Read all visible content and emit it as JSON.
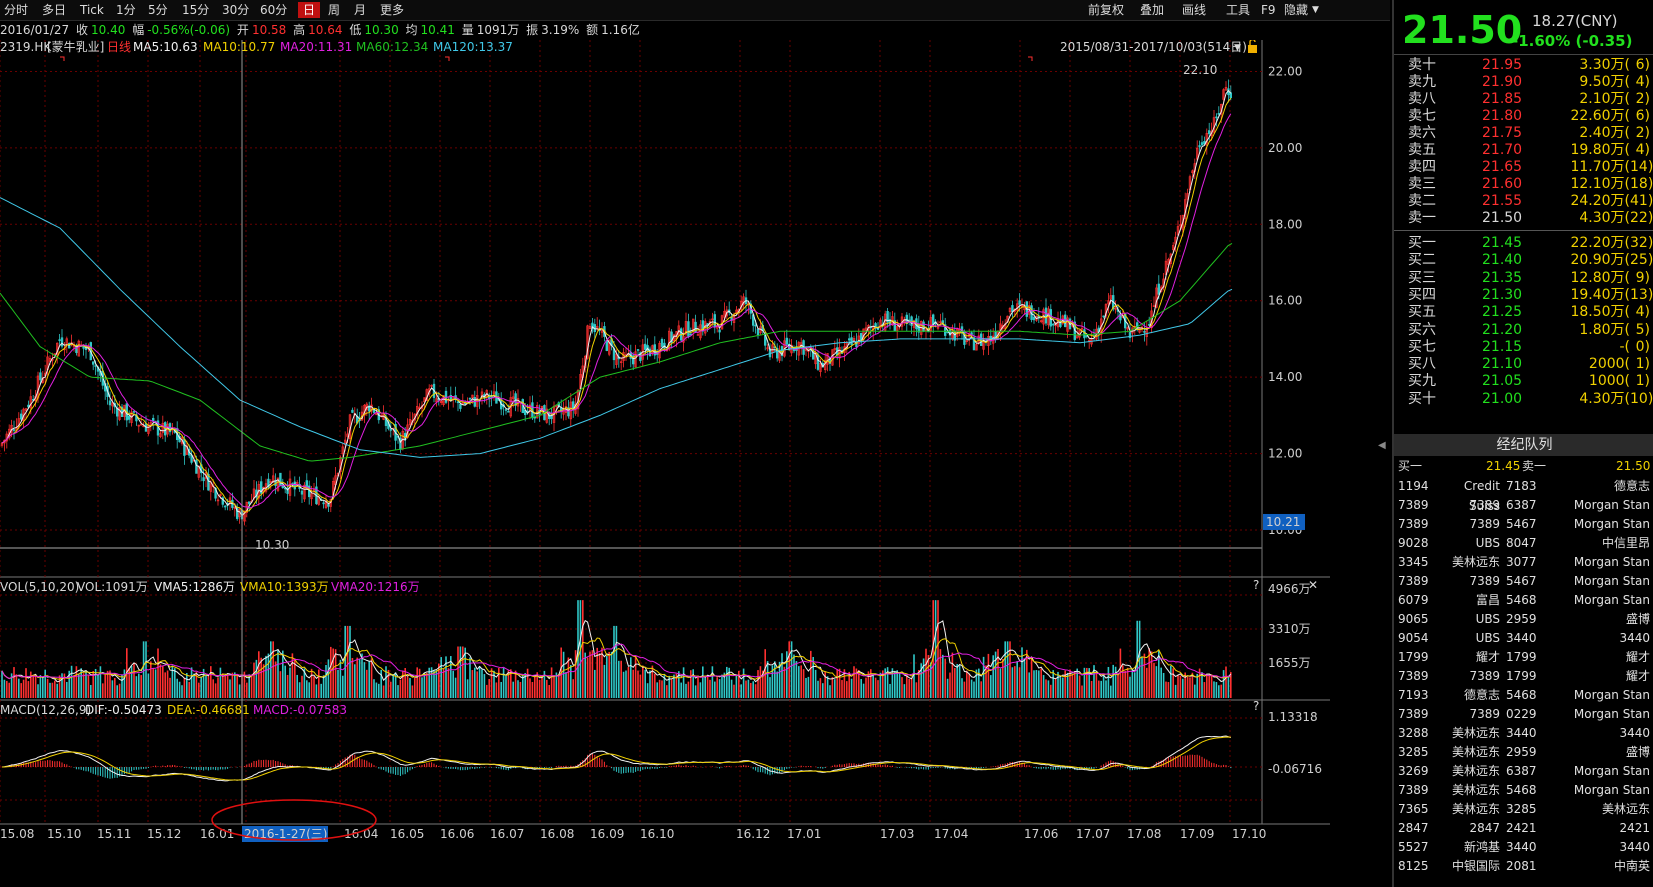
{
  "toolbar": {
    "items": [
      "分时",
      "多日",
      "Tick",
      "1分",
      "5分",
      "15分",
      "30分",
      "60分",
      "日",
      "周",
      "月",
      "更多"
    ],
    "active": "日",
    "right_items": [
      "前复权",
      "叠加",
      "画线",
      "工具",
      "F9",
      "隐藏"
    ]
  },
  "infoline": {
    "date": "2016/01/27",
    "close_label": "收",
    "close": "10.40",
    "change_label": "幅",
    "change": "-0.56%(-0.06)",
    "open_label": "开",
    "open": "10.58",
    "high_label": "高",
    "high": "10.64",
    "low_label": "低",
    "low": "10.30",
    "avg_label": "均",
    "avg": "10.41",
    "volume_label": "量",
    "volume": "1091万",
    "amplitude_label": "振",
    "amplitude": "3.19%",
    "turnover_label": "额",
    "turnover": "1.16亿"
  },
  "main_legend": {
    "symbol": "2319.HK",
    "name": "[蒙牛乳业]",
    "period": "日线",
    "ma5": "MA5:10.63",
    "ma10": "MA10:10.77",
    "ma20": "MA20:11.31",
    "ma60": "MA60:12.34",
    "ma120": "MA120:13.37",
    "range": "2015/08/31-2017/10/03(514日)"
  },
  "colors": {
    "up": "#ff3030",
    "down": "#30c8c8",
    "ma5": "#f0f0f0",
    "ma10": "#f0d000",
    "ma20": "#e020e0",
    "ma60": "#20c020",
    "ma120": "#40c8e8",
    "grid": "#6a0000",
    "green": "#22e01e"
  },
  "price_axis": {
    "labels": [
      "22.00",
      "20.00",
      "18.00",
      "16.00",
      "14.00",
      "12.00",
      "10.00"
    ],
    "current_marker": "10.21",
    "high_mark": "22.10",
    "low_mark": "10.30"
  },
  "vol_legend": {
    "name": "VOL(5,10,20)",
    "vol": "VOL:1091万",
    "vma5": "VMA5:1286万",
    "vma10": "VMA10:1393万",
    "vma20": "VMA20:1216万",
    "axis": [
      "4966万",
      "3310万",
      "1655万"
    ]
  },
  "macd_legend": {
    "name": "MACD(12,26,9)",
    "dif": "DIF:-0.50473",
    "dea": "DEA:-0.46681",
    "macd": "MACD:-0.07583",
    "axis": [
      "1.13318",
      "-0.06716"
    ]
  },
  "time_axis": {
    "labels": [
      "15.08",
      "15.10",
      "15.11",
      "15.12",
      "16.01",
      "16.04",
      "16.05",
      "16.06",
      "16.07",
      "16.08",
      "16.09",
      "16.10",
      "16.12",
      "17.01",
      "17.03",
      "17.04",
      "17.06",
      "17.07",
      "17.08",
      "17.09",
      "17.10"
    ],
    "cursor_label": "2016-1-27(三)"
  },
  "quote": {
    "price": "21.50",
    "ref": "18.27(CNY)",
    "change": "-1.60% (-0.35)"
  },
  "orderbook": {
    "asks": [
      {
        "label": "卖十",
        "price": "21.95",
        "vol": "3.30万(",
        "cnt": "6)"
      },
      {
        "label": "卖九",
        "price": "21.90",
        "vol": "9.50万(",
        "cnt": "4)"
      },
      {
        "label": "卖八",
        "price": "21.85",
        "vol": "2.10万(",
        "cnt": "2)"
      },
      {
        "label": "卖七",
        "price": "21.80",
        "vol": "22.60万(",
        "cnt": "6)"
      },
      {
        "label": "卖六",
        "price": "21.75",
        "vol": "2.40万(",
        "cnt": "2)"
      },
      {
        "label": "卖五",
        "price": "21.70",
        "vol": "19.80万(",
        "cnt": "4)"
      },
      {
        "label": "卖四",
        "price": "21.65",
        "vol": "11.70万(",
        "cnt": "14)"
      },
      {
        "label": "卖三",
        "price": "21.60",
        "vol": "12.10万(",
        "cnt": "18)"
      },
      {
        "label": "卖二",
        "price": "21.55",
        "vol": "24.20万(",
        "cnt": "41)"
      },
      {
        "label": "卖一",
        "price": "21.50",
        "vol": "4.30万(",
        "cnt": "22)"
      }
    ],
    "bids": [
      {
        "label": "买一",
        "price": "21.45",
        "vol": "22.20万(",
        "cnt": "32)"
      },
      {
        "label": "买二",
        "price": "21.40",
        "vol": "20.90万(",
        "cnt": "25)"
      },
      {
        "label": "买三",
        "price": "21.35",
        "vol": "12.80万(",
        "cnt": "9)"
      },
      {
        "label": "买四",
        "price": "21.30",
        "vol": "19.40万(",
        "cnt": "13)"
      },
      {
        "label": "买五",
        "price": "21.25",
        "vol": "18.50万(",
        "cnt": "4)"
      },
      {
        "label": "买六",
        "price": "21.20",
        "vol": "1.80万(",
        "cnt": "5)"
      },
      {
        "label": "买七",
        "price": "21.15",
        "vol": "-(",
        "cnt": "0)"
      },
      {
        "label": "买八",
        "price": "21.10",
        "vol": "2000(",
        "cnt": "1)"
      },
      {
        "label": "买九",
        "price": "21.05",
        "vol": "1000(",
        "cnt": "1)"
      },
      {
        "label": "买十",
        "price": "21.00",
        "vol": "4.30万(",
        "cnt": "10)"
      }
    ]
  },
  "broker": {
    "title": "经纪队列",
    "buy_label": "买一",
    "buy_price": "21.45",
    "sell_label": "卖一",
    "sell_price": "21.50",
    "rows": [
      [
        "1194",
        "Credit Suiss",
        "7183",
        "德意志"
      ],
      [
        "7389",
        "7389",
        "6387",
        "Morgan Stan"
      ],
      [
        "7389",
        "7389",
        "5467",
        "Morgan Stan"
      ],
      [
        "9028",
        "UBS",
        "8047",
        "中信里昂"
      ],
      [
        "3345",
        "美林远东",
        "3077",
        "Morgan Stan"
      ],
      [
        "7389",
        "7389",
        "5467",
        "Morgan Stan"
      ],
      [
        "6079",
        "富昌",
        "5468",
        "Morgan Stan"
      ],
      [
        "9065",
        "UBS",
        "2959",
        "盛博"
      ],
      [
        "9054",
        "UBS",
        "3440",
        "3440"
      ],
      [
        "1799",
        "耀才",
        "1799",
        "耀才"
      ],
      [
        "7389",
        "7389",
        "1799",
        "耀才"
      ],
      [
        "7193",
        "德意志",
        "5468",
        "Morgan Stan"
      ],
      [
        "7389",
        "7389",
        "0229",
        "Morgan Stan"
      ],
      [
        "3288",
        "美林远东",
        "3440",
        "3440"
      ],
      [
        "3285",
        "美林远东",
        "2959",
        "盛博"
      ],
      [
        "3269",
        "美林远东",
        "6387",
        "Morgan Stan"
      ],
      [
        "7389",
        "美林远东",
        "5468",
        "Morgan Stan"
      ],
      [
        "7365",
        "美林远东",
        "3285",
        "美林远东"
      ],
      [
        "2847",
        "2847",
        "2421",
        "2421"
      ],
      [
        "5527",
        "新鸿基",
        "3440",
        "3440"
      ],
      [
        "8125",
        "中银国际",
        "2081",
        "中南英"
      ]
    ]
  },
  "chart_data": {
    "type": "candlestick",
    "title": "2319.HK [蒙牛乳业] 日线",
    "x_range": [
      "2015/08/31",
      "2017/10/03"
    ],
    "bars": 514,
    "ylim": [
      10.0,
      22.3
    ],
    "close_path_key": [
      [
        0,
        12.2
      ],
      [
        30,
        13.4
      ],
      [
        60,
        15.0
      ],
      [
        90,
        14.7
      ],
      [
        110,
        13.3
      ],
      [
        140,
        12.8
      ],
      [
        175,
        12.5
      ],
      [
        210,
        11.2
      ],
      [
        240,
        10.4
      ],
      [
        270,
        11.4
      ],
      [
        300,
        11.0
      ],
      [
        330,
        10.8
      ],
      [
        350,
        12.8
      ],
      [
        370,
        13.3
      ],
      [
        400,
        12.3
      ],
      [
        430,
        13.6
      ],
      [
        460,
        13.3
      ],
      [
        490,
        13.5
      ],
      [
        520,
        13.2
      ],
      [
        550,
        13.0
      ],
      [
        575,
        13.2
      ],
      [
        590,
        15.5
      ],
      [
        620,
        14.4
      ],
      [
        650,
        14.7
      ],
      [
        690,
        15.3
      ],
      [
        720,
        15.4
      ],
      [
        745,
        16.0
      ],
      [
        770,
        14.6
      ],
      [
        800,
        14.9
      ],
      [
        820,
        14.3
      ],
      [
        850,
        14.8
      ],
      [
        880,
        15.5
      ],
      [
        910,
        15.3
      ],
      [
        940,
        15.4
      ],
      [
        970,
        14.9
      ],
      [
        990,
        15.0
      ],
      [
        1010,
        15.8
      ],
      [
        1040,
        15.7
      ],
      [
        1070,
        15.3
      ],
      [
        1090,
        14.9
      ],
      [
        1110,
        16.0
      ],
      [
        1130,
        15.1
      ],
      [
        1150,
        15.5
      ],
      [
        1160,
        16.5
      ],
      [
        1175,
        17.5
      ],
      [
        1190,
        19.2
      ],
      [
        1200,
        20.2
      ],
      [
        1215,
        20.6
      ],
      [
        1225,
        21.6
      ],
      [
        1230,
        21.5
      ]
    ],
    "ma120_key": [
      [
        0,
        18.7
      ],
      [
        60,
        17.9
      ],
      [
        120,
        16.3
      ],
      [
        180,
        14.8
      ],
      [
        240,
        13.4
      ],
      [
        300,
        12.7
      ],
      [
        360,
        12.1
      ],
      [
        420,
        11.9
      ],
      [
        480,
        12.0
      ],
      [
        540,
        12.4
      ],
      [
        600,
        13.0
      ],
      [
        660,
        13.7
      ],
      [
        720,
        14.2
      ],
      [
        780,
        14.7
      ],
      [
        840,
        14.9
      ],
      [
        900,
        15.0
      ],
      [
        960,
        15.0
      ],
      [
        1020,
        15.0
      ],
      [
        1080,
        14.9
      ],
      [
        1140,
        15.1
      ],
      [
        1190,
        15.4
      ],
      [
        1230,
        16.3
      ]
    ],
    "ma60_key": [
      [
        0,
        16.2
      ],
      [
        40,
        14.8
      ],
      [
        90,
        14.0
      ],
      [
        150,
        13.9
      ],
      [
        200,
        13.4
      ],
      [
        260,
        12.2
      ],
      [
        310,
        11.8
      ],
      [
        350,
        11.9
      ],
      [
        420,
        12.2
      ],
      [
        480,
        12.6
      ],
      [
        540,
        13.0
      ],
      [
        600,
        14.0
      ],
      [
        660,
        14.4
      ],
      [
        720,
        14.9
      ],
      [
        780,
        15.2
      ],
      [
        840,
        15.2
      ],
      [
        900,
        15.2
      ],
      [
        960,
        15.2
      ],
      [
        1020,
        15.2
      ],
      [
        1080,
        15.1
      ],
      [
        1130,
        15.2
      ],
      [
        1180,
        16.0
      ],
      [
        1230,
        17.5
      ]
    ]
  }
}
